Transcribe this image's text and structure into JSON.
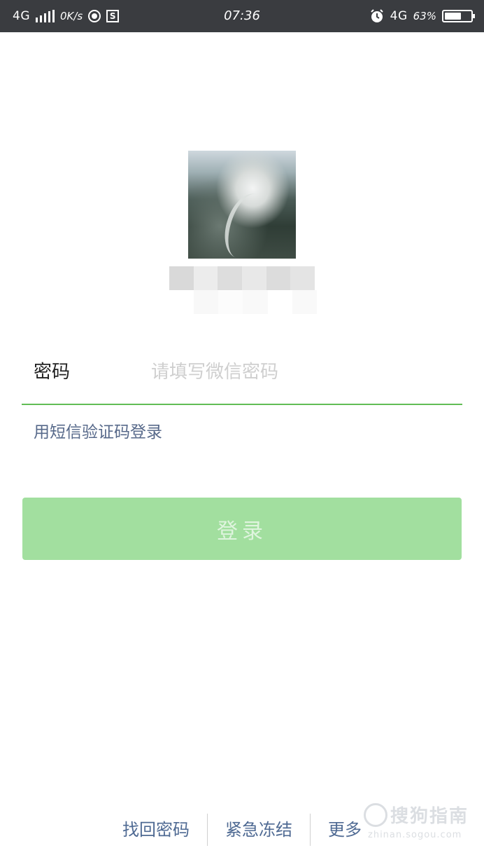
{
  "status_bar": {
    "network": "4G",
    "speed": "0K/s",
    "time": "07:36",
    "network_right": "4G",
    "battery": "63%",
    "battery_level": 0.63,
    "icons": [
      "signal-icon",
      "app-circle-icon",
      "s-app-icon",
      "alarm-icon",
      "battery-icon"
    ]
  },
  "login": {
    "password_label": "密码",
    "password_placeholder": "请填写微信密码",
    "password_value": "",
    "sms_login_link": "用短信验证码登录",
    "login_button": "登录"
  },
  "footer": {
    "links": [
      "找回密码",
      "紧急冻结",
      "更多"
    ]
  },
  "watermark": {
    "name": "搜狗指南",
    "url": "zhinan.sogou.com"
  },
  "colors": {
    "status_bar_bg": "#3a3c40",
    "accent_green": "#62bd55",
    "login_button_disabled": "#a2df9f",
    "link_blue": "#57698a"
  }
}
